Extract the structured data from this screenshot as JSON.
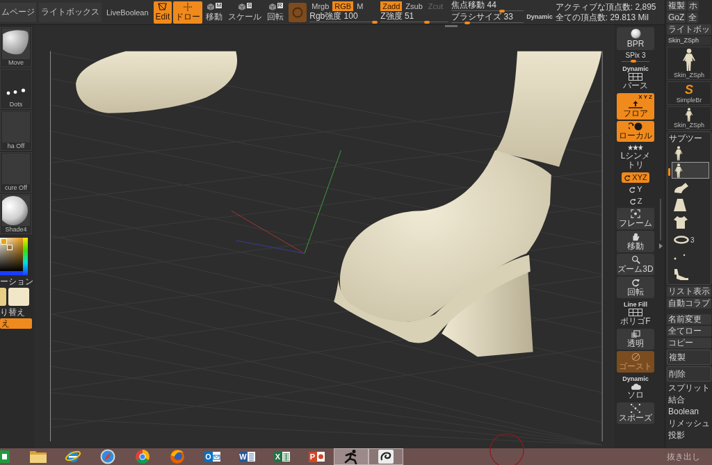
{
  "top_bar": {
    "page_tab": "ムページ",
    "text_buttons": [
      "ライトボックス",
      "LiveBoolean"
    ],
    "tools": [
      {
        "kind": "edit",
        "label": "Edit",
        "selected": true
      },
      {
        "kind": "draw",
        "label": "ドロー",
        "selected": true
      },
      {
        "kind": "move",
        "key": "M",
        "label": "移動",
        "selected": false
      },
      {
        "kind": "scale",
        "key": "S",
        "label": "スケール",
        "selected": false
      },
      {
        "kind": "rotate",
        "key": "R",
        "label": "回転",
        "selected": false
      }
    ],
    "rgb_modes": [
      {
        "label": "Mrgb",
        "selected": false
      },
      {
        "label": "RGB",
        "selected": true
      },
      {
        "label": "M",
        "selected": false
      }
    ],
    "z_modes": [
      {
        "label": "Zadd",
        "selected": true,
        "disabled": false
      },
      {
        "label": "Zsub",
        "selected": false,
        "disabled": false
      },
      {
        "label": "Zcut",
        "selected": false,
        "disabled": true
      }
    ],
    "sliders": [
      {
        "label": "Rgb強度 100",
        "level": 1
      },
      {
        "label": "Z強度 51",
        "level": 0.7
      }
    ],
    "brush_sliders": [
      {
        "label": "焦点移動 44",
        "level": 0.72
      },
      {
        "label": "ブラシサイズ 33",
        "level": 0.2
      }
    ],
    "dynamic_label": "Dynamic",
    "stats": [
      "アクティブな頂点数: 2,895",
      "全ての頂点数: 29.813 Mil"
    ]
  },
  "left_panel": {
    "tools": [
      {
        "kind": "brush",
        "label": "Move"
      },
      {
        "kind": "stroke",
        "label": "Dots"
      },
      {
        "kind": "alpha",
        "label": "ha Off"
      },
      {
        "kind": "texture",
        "label": "cure Off"
      },
      {
        "kind": "material",
        "label": "Shade4"
      }
    ],
    "gradient_button": "ーション",
    "swatches": [
      {
        "color": "#e8cf86"
      },
      {
        "color": "#f2e6c8"
      }
    ],
    "switch_button": "り替え",
    "action_button": "え"
  },
  "shelf": {
    "bpr_button": {
      "label": "BPR"
    },
    "spix": {
      "label": "SPix 3",
      "level": 0.4
    },
    "buttons": [
      {
        "kind": "persp",
        "caption": "Dynamic",
        "label": "パース",
        "on": false,
        "dimmed": false
      },
      {
        "kind": "floor",
        "axes": "X Y Z",
        "label": "フロア",
        "on": true,
        "dimmed": false
      },
      {
        "kind": "local",
        "label": "ローカル",
        "on": true,
        "dimmed": false
      },
      {
        "kind": "lsym",
        "label": "Lシンメトリ",
        "on": false,
        "dimmed": false
      },
      {
        "kind": "xyz",
        "label": "XYZ",
        "on": true,
        "dimmed": false
      },
      {
        "kind": "y",
        "label": "Y",
        "on": false,
        "dimmed": false
      },
      {
        "kind": "z",
        "label": "Z",
        "on": false,
        "dimmed": false
      },
      {
        "kind": "frame",
        "label": "フレーム",
        "on": false,
        "dimmed": false
      },
      {
        "kind": "move",
        "label": "移動",
        "on": false,
        "dimmed": false
      },
      {
        "kind": "zoom",
        "label": "ズーム3D",
        "on": false,
        "dimmed": false
      },
      {
        "kind": "rotate",
        "label": "回転",
        "on": false,
        "dimmed": false
      },
      {
        "kind": "polyf",
        "caption": "Line Fill",
        "label": "ポリゴF",
        "on": false,
        "dimmed": false
      },
      {
        "kind": "transp",
        "label": "透明",
        "on": false,
        "dimmed": false
      },
      {
        "kind": "ghost",
        "label": "ゴースト",
        "on": true,
        "dimmed": true
      },
      {
        "kind": "solo",
        "caption": "Dynamic",
        "label": "ソロ",
        "on": false,
        "dimmed": false
      },
      {
        "kind": "transpose",
        "label": "スポーズ",
        "on": false,
        "dimmed": false
      }
    ]
  },
  "right_panel": {
    "top_rows": [
      {
        "buttons": [
          "複製",
          "ホ"
        ]
      },
      {
        "buttons": [
          "GoZ",
          "全"
        ]
      }
    ],
    "lightbox_button": "ライトボッ",
    "tool_name": "Skin_ZSph",
    "tool_thumbs": [
      {
        "kind": "figure",
        "label": "Skin_ZSph"
      },
      {
        "kind": "logo",
        "glyph": "S",
        "label": "SimpleBr"
      },
      {
        "kind": "figure",
        "label": "Skin_ZSph"
      }
    ],
    "subtool": {
      "title": "サブツー",
      "items": [
        {
          "kind": "figure",
          "selected": false
        },
        {
          "kind": "figure",
          "selected": true
        },
        {
          "kind": "limb",
          "selected": false
        },
        {
          "kind": "skirt",
          "selected": false
        },
        {
          "kind": "top",
          "selected": false
        },
        {
          "kind": "ring",
          "label": "3",
          "selected": false
        },
        {
          "kind": "dots",
          "selected": false
        },
        {
          "kind": "shoe",
          "selected": false
        }
      ]
    },
    "list_buttons": [
      "リスト表示",
      "自動コラプ"
    ],
    "actions": [
      {
        "kind": "button",
        "label": "名前変更"
      },
      {
        "kind": "button",
        "label": "全てロー"
      },
      {
        "kind": "button",
        "label": "コピー"
      },
      {
        "kind": "large",
        "label": "複製"
      },
      {
        "kind": "large",
        "label": "削除"
      },
      {
        "kind": "header",
        "label": "スプリット"
      },
      {
        "kind": "header",
        "label": "結合"
      },
      {
        "kind": "header",
        "label": "Boolean"
      },
      {
        "kind": "header",
        "label": "リメッシュ"
      },
      {
        "kind": "header",
        "label": "投影"
      },
      {
        "kind": "header",
        "label": "抜き出し"
      }
    ]
  },
  "taskbar": {
    "apps": [
      {
        "kind": "tile",
        "active": false
      },
      {
        "kind": "folder",
        "active": false
      },
      {
        "kind": "globe",
        "active": false
      },
      {
        "kind": "compass",
        "active": false
      },
      {
        "kind": "circle",
        "active": false
      },
      {
        "kind": "flame",
        "active": false
      },
      {
        "kind": "mail",
        "glyph": "O",
        "active": false
      },
      {
        "kind": "doc",
        "glyph": "W",
        "active": false
      },
      {
        "kind": "sheet",
        "glyph": "X",
        "active": false
      },
      {
        "kind": "slides",
        "glyph": "P",
        "active": false
      },
      {
        "kind": "runner",
        "active": true
      },
      {
        "kind": "swirl",
        "active": true
      }
    ]
  }
}
